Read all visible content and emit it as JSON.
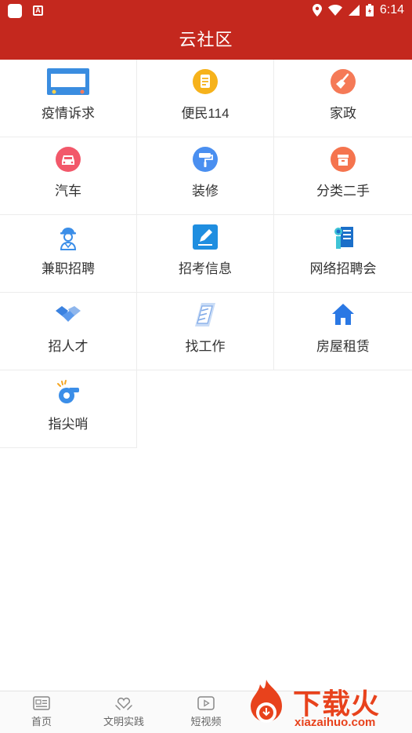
{
  "status_bar": {
    "time": "6:14"
  },
  "header": {
    "title": "云社区"
  },
  "banner": {
    "text": "疫情诉求"
  },
  "grid": {
    "items": [
      {
        "label": "疫情诉求",
        "icon": "epidemic-banner-icon"
      },
      {
        "label": "便民114",
        "icon": "phone-book-icon"
      },
      {
        "label": "家政",
        "icon": "broom-icon"
      },
      {
        "label": "汽车",
        "icon": "car-icon"
      },
      {
        "label": "装修",
        "icon": "paint-roller-icon"
      },
      {
        "label": "分类二手",
        "icon": "box-icon"
      },
      {
        "label": "兼职招聘",
        "icon": "worker-icon"
      },
      {
        "label": "招考信息",
        "icon": "pencil-note-icon"
      },
      {
        "label": "网络招聘会",
        "icon": "person-board-icon"
      },
      {
        "label": "招人才",
        "icon": "handshake-icon"
      },
      {
        "label": "找工作",
        "icon": "checklist-icon"
      },
      {
        "label": "房屋租赁",
        "icon": "house-icon"
      },
      {
        "label": "指尖哨",
        "icon": "whistle-icon"
      }
    ]
  },
  "bottom_nav": {
    "items": [
      {
        "label": "首页",
        "icon": "news-icon"
      },
      {
        "label": "文明实践",
        "icon": "heart-hands-icon"
      },
      {
        "label": "短视频",
        "icon": "video-play-icon"
      }
    ]
  },
  "watermark": {
    "brand": "下载火",
    "domain": "xiazaihuo.com"
  },
  "colors": {
    "header_red": "#c4281e",
    "watermark_orange": "#e8421c"
  }
}
